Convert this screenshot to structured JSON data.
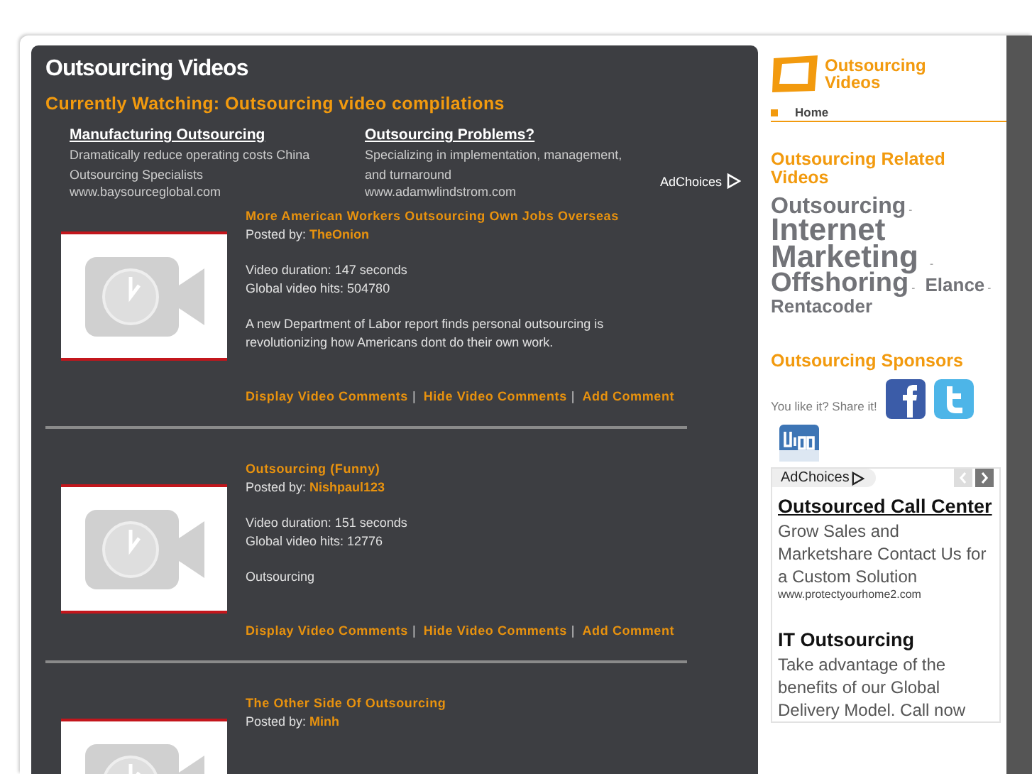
{
  "main": {
    "title": "Outsourcing Videos",
    "now_watching": "Currently Watching: Outsourcing video compilations",
    "ads": [
      {
        "title": "Manufacturing Outsourcing",
        "text": "Dramatically reduce operating costs China Outsourcing Specialists",
        "url": "www.baysourceglobal.com"
      },
      {
        "title": "Outsourcing Problems?",
        "text": "Specializing in implementation, management, and turnaround",
        "url": "www.adamwlindstrom.com"
      }
    ],
    "adchoices": "AdChoices",
    "videos": [
      {
        "title": "More American Workers Outsourcing Own Jobs Overseas",
        "posted_label": "Posted by:",
        "author": "TheOnion",
        "duration": "Video duration: 147 seconds",
        "hits": "Global video hits: 504780",
        "description": "A new Department of Labor report finds personal outsourcing is revolutionizing how Americans dont do their own work.",
        "separator": "|",
        "actions": [
          "Display Video Comments",
          "Hide Video Comments",
          "Add Comment"
        ]
      },
      {
        "title": "Outsourcing (Funny)",
        "posted_label": "Posted by:",
        "author": "Nishpaul123",
        "duration": "Video duration: 151 seconds",
        "hits": "Global video hits: 12776",
        "description": "Outsourcing",
        "separator": "|",
        "actions": [
          "Display Video Comments",
          "Hide Video Comments",
          "Add Comment"
        ]
      },
      {
        "title": "The Other Side Of Outsourcing",
        "posted_label": "Posted by:",
        "author": "Minh"
      }
    ]
  },
  "sidebar": {
    "logo_text": "Outsourcing Videos",
    "nav": [
      {
        "label": "Home",
        "selected": true
      }
    ],
    "related_title": "Outsourcing Related Videos",
    "tag_separator": "-",
    "tags": [
      {
        "label": "Outsourcing",
        "kind": "medium"
      },
      {
        "label": "Internet Marketing",
        "kind": "huge"
      },
      {
        "label": "Offshoring",
        "kind": "large"
      },
      {
        "label": "Elance",
        "kind": "small"
      },
      {
        "label": "Rentacoder",
        "kind": "small"
      }
    ],
    "sponsors_title": "Outsourcing Sponsors",
    "share_text": "You like it? Share it!",
    "ad_box": {
      "adchoices": "AdChoices",
      "ads": [
        {
          "title": "Outsourced Call Center",
          "text": "Grow Sales and Marketshare Contact Us for a Custom Solution",
          "url": "www.protectyourhome2.com"
        },
        {
          "title": "IT Outsourcing",
          "text": "Take advantage of the benefits of our Global Delivery Model. Call now"
        }
      ]
    }
  }
}
